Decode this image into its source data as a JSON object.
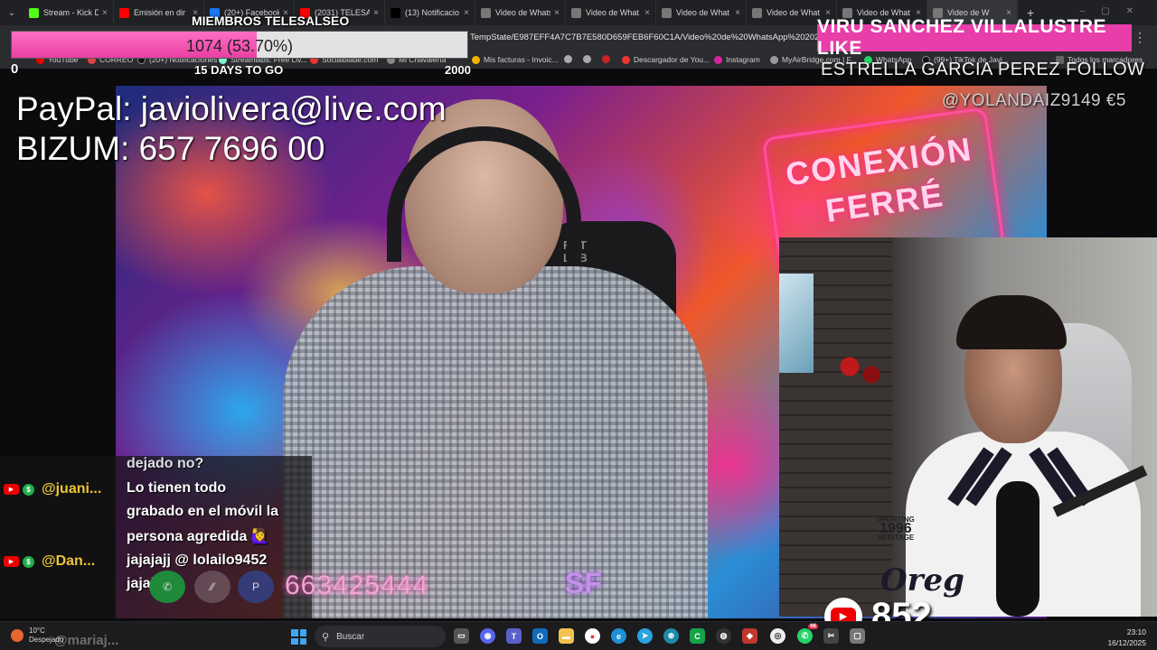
{
  "browser": {
    "tabs": [
      {
        "label": "Stream - Kick D",
        "icon": "kick-icon",
        "color": "#53fc18"
      },
      {
        "label": "Emisión en dir",
        "icon": "youtube-icon",
        "color": "#ff0000"
      },
      {
        "label": "(20+) Facebook",
        "icon": "facebook-icon",
        "color": "#1877f2"
      },
      {
        "label": "(2031) TELESAL",
        "icon": "youtube-icon",
        "color": "#ff0000"
      },
      {
        "label": "(13) Notificacio",
        "icon": "x-icon",
        "color": "#000000"
      },
      {
        "label": "Video de Whats",
        "icon": "globe-icon",
        "color": "#777777"
      },
      {
        "label": "Video de What",
        "icon": "globe-icon",
        "color": "#777777"
      },
      {
        "label": "Video de What",
        "icon": "globe-icon",
        "color": "#777777"
      },
      {
        "label": "Video de What",
        "icon": "globe-icon",
        "color": "#777777"
      },
      {
        "label": "Video de What",
        "icon": "globe-icon",
        "color": "#777777"
      },
      {
        "label": "Video de W",
        "icon": "globe-icon",
        "color": "#777777"
      }
    ],
    "url": "TempState/E987EFF4A7C7B7E580D659FEB6F60C1A/Video%20de%20WhatsApp%202025-12-",
    "bookmarks": [
      {
        "label": "YouTube"
      },
      {
        "label": "CORREO"
      },
      {
        "label": "(20+) Notificaciones"
      },
      {
        "label": "Streamlabs: Free Liv..."
      },
      {
        "label": "Socialblade.com"
      },
      {
        "label": "Mi Chavalería"
      },
      {
        "label": "Mis facturas - Invoic..."
      },
      {
        "label": "Descargador de You..."
      },
      {
        "label": "Instagram"
      },
      {
        "label": "MyAirBridge.com | F..."
      },
      {
        "label": "WhatsApp"
      },
      {
        "label": "(99+) TikTok de Javi..."
      },
      {
        "label": "Todos los marcadores"
      }
    ]
  },
  "goal": {
    "title": "MIEMBROS TELESALSEO",
    "text": "1074 (53.70%)",
    "progress": 0.537,
    "min": "0",
    "days_left": "15 DAYS TO GO",
    "max": "2000"
  },
  "alerts": {
    "like": "VIRU SANCHEZ VILLALUSTRE  LIKE",
    "follow": "ESTRELLA GARCIA PEREZ  FOLLOW",
    "donation": "@YOLANDAIZ9149  €5"
  },
  "donations": {
    "paypal": "PayPal: javiolivera@live.com",
    "bizum": "BIZUM: 657 7696 00"
  },
  "stage": {
    "neon_line1": "CONEXIÓN",
    "neon_line2": "FERRÉ",
    "chair_logo_line1": "RET",
    "chair_logo_line2": "LAB",
    "phone": "663425444",
    "sf": "SF"
  },
  "webcam": {
    "shirt_line1": "SPORTING",
    "shirt_year": "1996",
    "shirt_line2": "HERITAGE",
    "shirt_big": "Oreg"
  },
  "chat": {
    "lines": [
      "dejado no?",
      "Lo tienen todo",
      "grabado en el móvil la",
      "persona agredida 🙋‍♀️",
      "jajajajj @ lolailo9452",
      "jajajajj"
    ],
    "users": [
      "@juani...",
      "@Dan..."
    ],
    "ghost": "@mariaj..."
  },
  "youtube_counter": "852",
  "taskbar": {
    "weather_temp": "10°C",
    "weather_desc": "Despejado",
    "search_placeholder": "Buscar",
    "time": "23:10",
    "date": "16/12/2025",
    "whatsapp_badge": "66"
  }
}
